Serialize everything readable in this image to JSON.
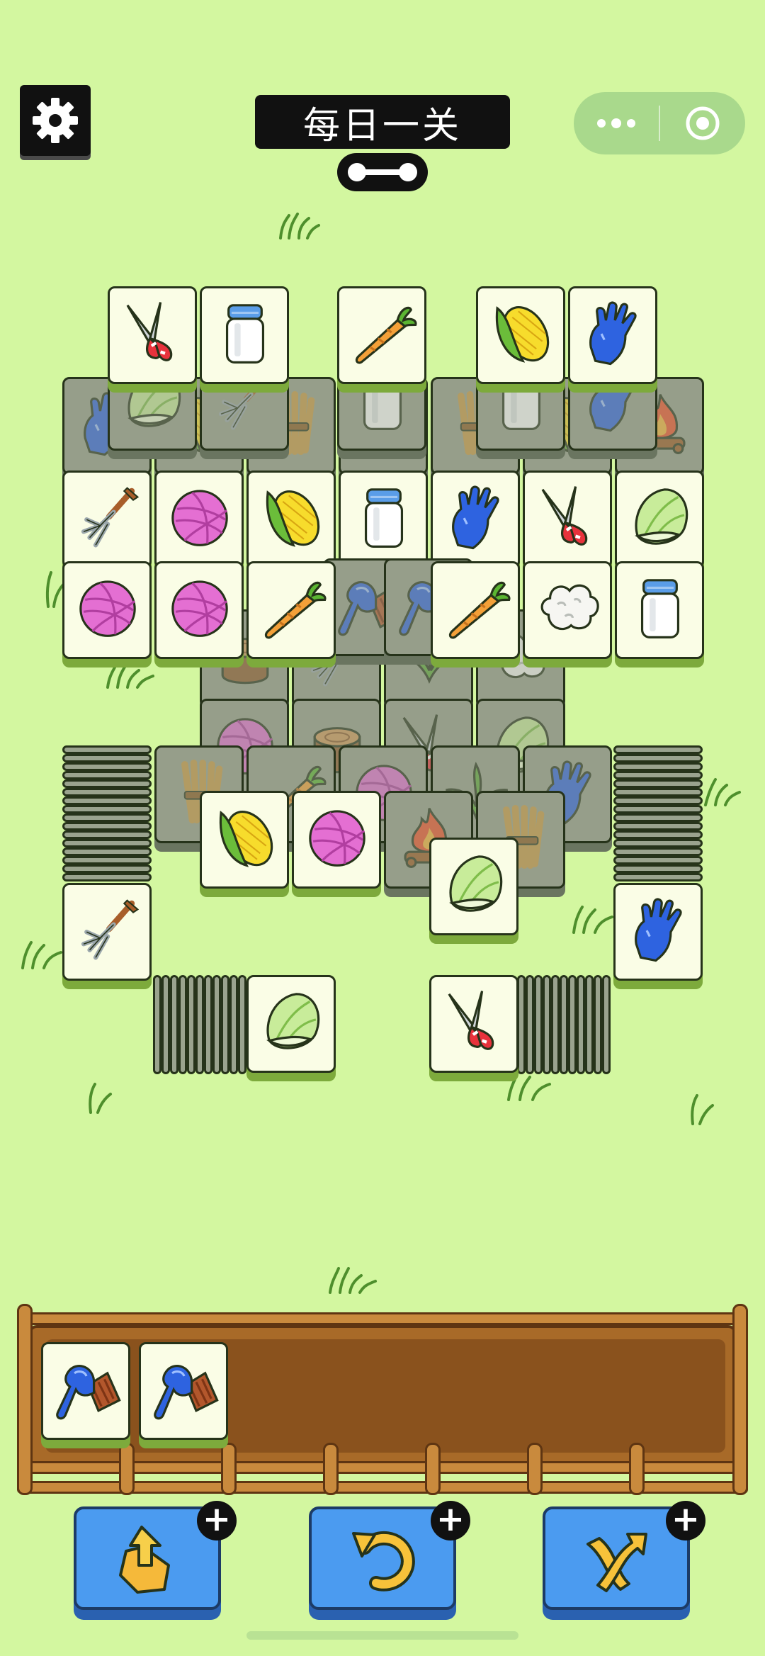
{
  "header": {
    "title": "每日一关"
  },
  "buttons": [
    {
      "name": "move-out-button",
      "icon": "move-out-icon",
      "plus": "+"
    },
    {
      "name": "undo-button",
      "icon": "undo-icon",
      "plus": "+"
    },
    {
      "name": "shuffle-button",
      "icon": "shuffle-icon",
      "plus": "+"
    }
  ],
  "tray": {
    "slots": 7,
    "tiles": [
      "brush",
      "brush"
    ]
  },
  "colors": {
    "background": "#d3f7a0",
    "tile_face": "#fafde6",
    "tile_shadow": "#7daa3c",
    "button_blue": "#4b9bf0",
    "tray_wood": "#a86a28"
  }
}
